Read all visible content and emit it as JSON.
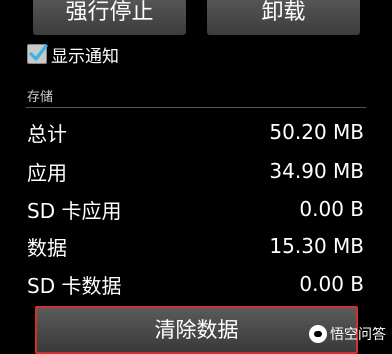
{
  "top_buttons": {
    "force_stop": "强行停止",
    "uninstall": "卸载"
  },
  "notification": {
    "label": "显示通知",
    "checked": true
  },
  "storage": {
    "header": "存储",
    "rows": [
      {
        "label": "总计",
        "value": "50.20 MB"
      },
      {
        "label": "应用",
        "value": "34.90 MB"
      },
      {
        "label": "SD 卡应用",
        "value": "0.00 B"
      },
      {
        "label": "数据",
        "value": "15.30 MB"
      },
      {
        "label": "SD 卡数据",
        "value": "0.00 B"
      }
    ],
    "clear_data": "清除数据"
  },
  "watermark": {
    "text": "悟空问答"
  }
}
